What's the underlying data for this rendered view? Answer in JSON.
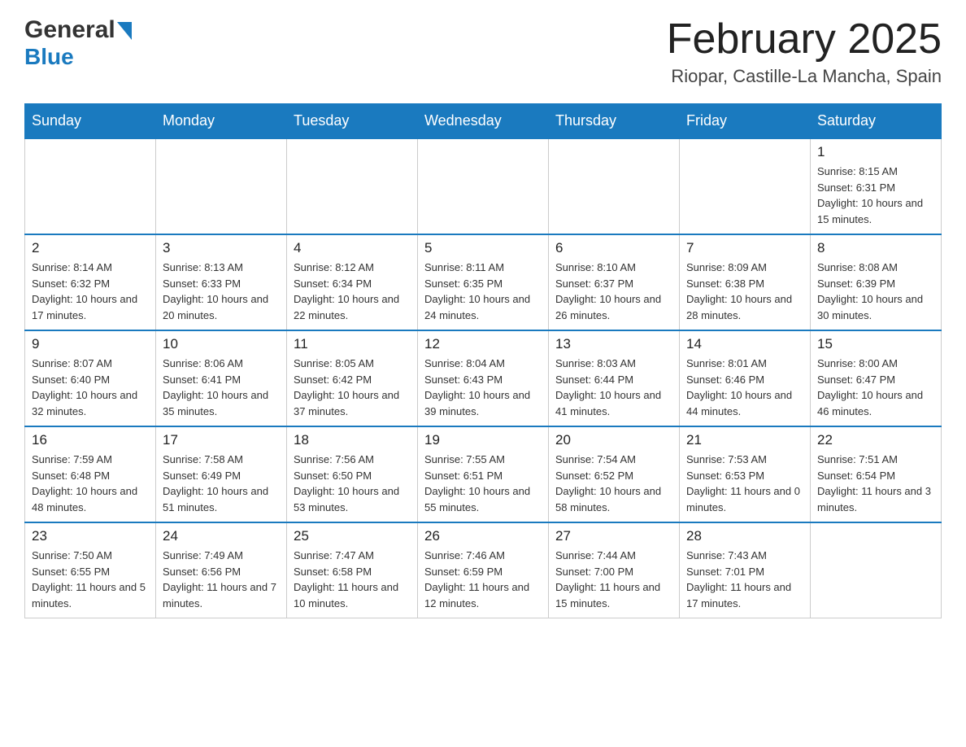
{
  "header": {
    "logo_general": "General",
    "logo_blue": "Blue",
    "month_title": "February 2025",
    "location": "Riopar, Castille-La Mancha, Spain"
  },
  "weekdays": [
    "Sunday",
    "Monday",
    "Tuesday",
    "Wednesday",
    "Thursday",
    "Friday",
    "Saturday"
  ],
  "weeks": [
    {
      "days": [
        {
          "number": "",
          "info": "",
          "empty": true
        },
        {
          "number": "",
          "info": "",
          "empty": true
        },
        {
          "number": "",
          "info": "",
          "empty": true
        },
        {
          "number": "",
          "info": "",
          "empty": true
        },
        {
          "number": "",
          "info": "",
          "empty": true
        },
        {
          "number": "",
          "info": "",
          "empty": true
        },
        {
          "number": "1",
          "info": "Sunrise: 8:15 AM\nSunset: 6:31 PM\nDaylight: 10 hours and 15 minutes.",
          "empty": false
        }
      ]
    },
    {
      "days": [
        {
          "number": "2",
          "info": "Sunrise: 8:14 AM\nSunset: 6:32 PM\nDaylight: 10 hours and 17 minutes.",
          "empty": false
        },
        {
          "number": "3",
          "info": "Sunrise: 8:13 AM\nSunset: 6:33 PM\nDaylight: 10 hours and 20 minutes.",
          "empty": false
        },
        {
          "number": "4",
          "info": "Sunrise: 8:12 AM\nSunset: 6:34 PM\nDaylight: 10 hours and 22 minutes.",
          "empty": false
        },
        {
          "number": "5",
          "info": "Sunrise: 8:11 AM\nSunset: 6:35 PM\nDaylight: 10 hours and 24 minutes.",
          "empty": false
        },
        {
          "number": "6",
          "info": "Sunrise: 8:10 AM\nSunset: 6:37 PM\nDaylight: 10 hours and 26 minutes.",
          "empty": false
        },
        {
          "number": "7",
          "info": "Sunrise: 8:09 AM\nSunset: 6:38 PM\nDaylight: 10 hours and 28 minutes.",
          "empty": false
        },
        {
          "number": "8",
          "info": "Sunrise: 8:08 AM\nSunset: 6:39 PM\nDaylight: 10 hours and 30 minutes.",
          "empty": false
        }
      ]
    },
    {
      "days": [
        {
          "number": "9",
          "info": "Sunrise: 8:07 AM\nSunset: 6:40 PM\nDaylight: 10 hours and 32 minutes.",
          "empty": false
        },
        {
          "number": "10",
          "info": "Sunrise: 8:06 AM\nSunset: 6:41 PM\nDaylight: 10 hours and 35 minutes.",
          "empty": false
        },
        {
          "number": "11",
          "info": "Sunrise: 8:05 AM\nSunset: 6:42 PM\nDaylight: 10 hours and 37 minutes.",
          "empty": false
        },
        {
          "number": "12",
          "info": "Sunrise: 8:04 AM\nSunset: 6:43 PM\nDaylight: 10 hours and 39 minutes.",
          "empty": false
        },
        {
          "number": "13",
          "info": "Sunrise: 8:03 AM\nSunset: 6:44 PM\nDaylight: 10 hours and 41 minutes.",
          "empty": false
        },
        {
          "number": "14",
          "info": "Sunrise: 8:01 AM\nSunset: 6:46 PM\nDaylight: 10 hours and 44 minutes.",
          "empty": false
        },
        {
          "number": "15",
          "info": "Sunrise: 8:00 AM\nSunset: 6:47 PM\nDaylight: 10 hours and 46 minutes.",
          "empty": false
        }
      ]
    },
    {
      "days": [
        {
          "number": "16",
          "info": "Sunrise: 7:59 AM\nSunset: 6:48 PM\nDaylight: 10 hours and 48 minutes.",
          "empty": false
        },
        {
          "number": "17",
          "info": "Sunrise: 7:58 AM\nSunset: 6:49 PM\nDaylight: 10 hours and 51 minutes.",
          "empty": false
        },
        {
          "number": "18",
          "info": "Sunrise: 7:56 AM\nSunset: 6:50 PM\nDaylight: 10 hours and 53 minutes.",
          "empty": false
        },
        {
          "number": "19",
          "info": "Sunrise: 7:55 AM\nSunset: 6:51 PM\nDaylight: 10 hours and 55 minutes.",
          "empty": false
        },
        {
          "number": "20",
          "info": "Sunrise: 7:54 AM\nSunset: 6:52 PM\nDaylight: 10 hours and 58 minutes.",
          "empty": false
        },
        {
          "number": "21",
          "info": "Sunrise: 7:53 AM\nSunset: 6:53 PM\nDaylight: 11 hours and 0 minutes.",
          "empty": false
        },
        {
          "number": "22",
          "info": "Sunrise: 7:51 AM\nSunset: 6:54 PM\nDaylight: 11 hours and 3 minutes.",
          "empty": false
        }
      ]
    },
    {
      "days": [
        {
          "number": "23",
          "info": "Sunrise: 7:50 AM\nSunset: 6:55 PM\nDaylight: 11 hours and 5 minutes.",
          "empty": false
        },
        {
          "number": "24",
          "info": "Sunrise: 7:49 AM\nSunset: 6:56 PM\nDaylight: 11 hours and 7 minutes.",
          "empty": false
        },
        {
          "number": "25",
          "info": "Sunrise: 7:47 AM\nSunset: 6:58 PM\nDaylight: 11 hours and 10 minutes.",
          "empty": false
        },
        {
          "number": "26",
          "info": "Sunrise: 7:46 AM\nSunset: 6:59 PM\nDaylight: 11 hours and 12 minutes.",
          "empty": false
        },
        {
          "number": "27",
          "info": "Sunrise: 7:44 AM\nSunset: 7:00 PM\nDaylight: 11 hours and 15 minutes.",
          "empty": false
        },
        {
          "number": "28",
          "info": "Sunrise: 7:43 AM\nSunset: 7:01 PM\nDaylight: 11 hours and 17 minutes.",
          "empty": false
        },
        {
          "number": "",
          "info": "",
          "empty": true
        }
      ]
    }
  ]
}
